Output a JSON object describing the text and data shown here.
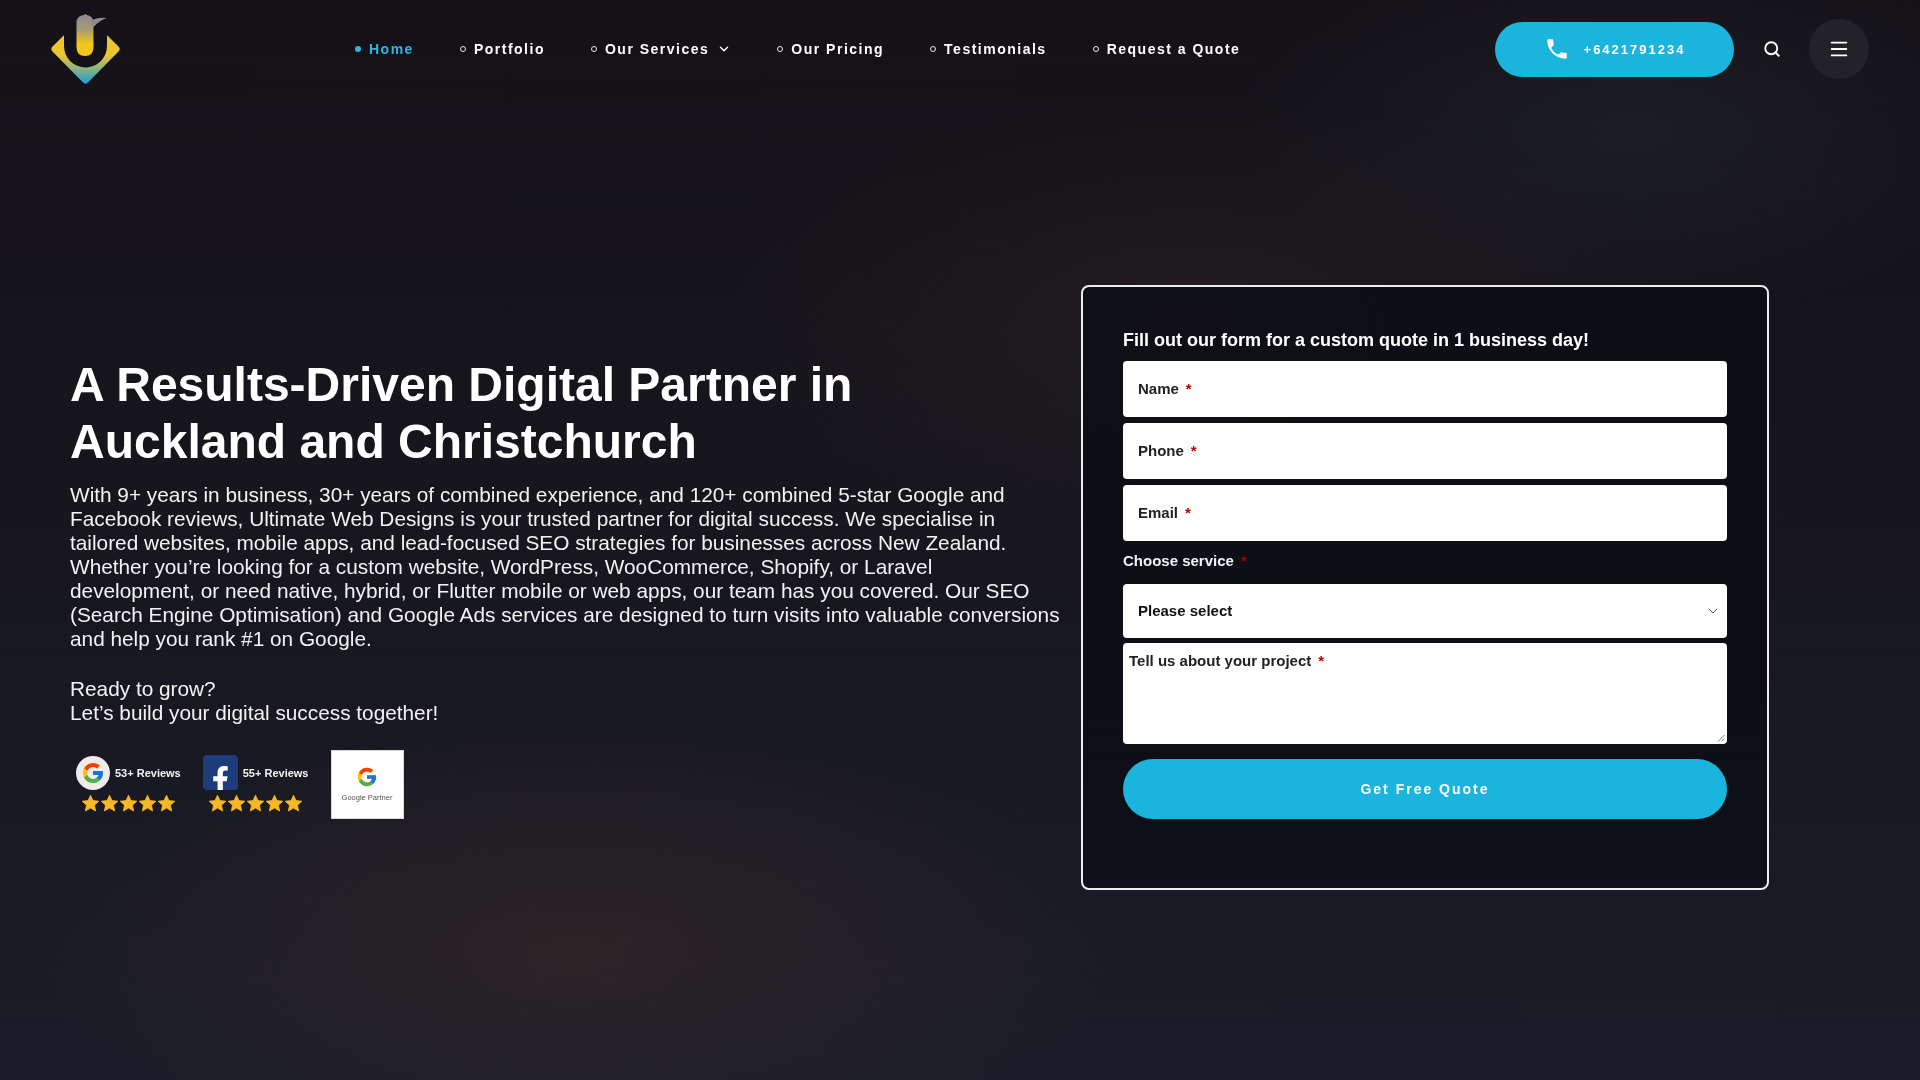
{
  "header": {
    "nav": [
      {
        "label": "Home",
        "selected": true,
        "has_submenu": false
      },
      {
        "label": "Portfolio",
        "selected": false,
        "has_submenu": false
      },
      {
        "label": "Our Services",
        "selected": false,
        "has_submenu": true
      },
      {
        "label": "Our Pricing",
        "selected": false,
        "has_submenu": false
      },
      {
        "label": "Testimonials",
        "selected": false,
        "has_submenu": false
      },
      {
        "label": "Request a Quote",
        "selected": false,
        "has_submenu": false
      }
    ],
    "phone_button": {
      "label": "+6421791234"
    }
  },
  "hero": {
    "heading": "A Results-Driven Digital Partner in Auckland and Christchurch",
    "intro": "With 9+ years in business, 30+ years of combined experience, and 120+ combined 5-star Google and Facebook reviews, Ultimate Web Designs is your trusted partner for digital success. We specialise in tailored websites, mobile apps, and lead-focused SEO strategies for businesses across New Zealand. Whether you’re looking for a custom website, WordPress, WooCommerce, Shopify, or Laravel development, or need native, hybrid, or Flutter mobile or web apps, our team has you covered. Our SEO (Search Engine Optimisation) and Google Ads services are designed to turn visits into valuable conversions and help you rank #1 on Google.",
    "closing_lines": [
      "Ready to grow?",
      "Let’s build your digital success together!"
    ],
    "reviews": [
      {
        "kind": "google",
        "label": "53+ Reviews",
        "stars": 5
      },
      {
        "kind": "facebook",
        "label": "55+ Reviews",
        "stars": 5
      }
    ],
    "partner_badge": {
      "label": "Google Partner"
    }
  },
  "quote_form": {
    "title": "Fill out our form for a custom quote in 1 business day!",
    "fields": [
      {
        "label": "Name",
        "required_mark": "*"
      },
      {
        "label": "Phone",
        "required_mark": "*"
      },
      {
        "label": "Email",
        "required_mark": "*"
      }
    ],
    "service": {
      "label": "Choose service",
      "required_mark": "*",
      "value": "Please select"
    },
    "project": {
      "label": "Tell us about your project",
      "required_mark": "*"
    },
    "submit": "Get Free Quote"
  }
}
